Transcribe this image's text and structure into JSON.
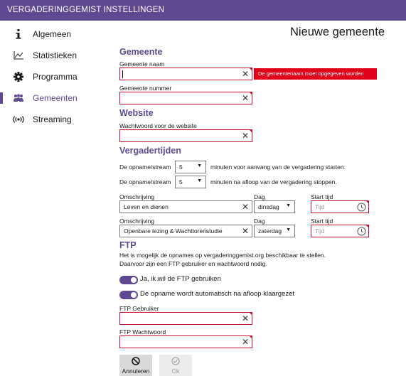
{
  "window": {
    "title": "VERGADERINGGEMIST INSTELLINGEN"
  },
  "sidebar": {
    "items": [
      {
        "label": "Algemeen",
        "icon": "info-icon"
      },
      {
        "label": "Statistieken",
        "icon": "chart-icon"
      },
      {
        "label": "Programma",
        "icon": "gear-icon"
      },
      {
        "label": "Gemeenten",
        "icon": "people-icon",
        "active": true
      },
      {
        "label": "Streaming",
        "icon": "broadcast-icon"
      }
    ]
  },
  "page": {
    "title": "Nieuwe gemeente"
  },
  "gemeente": {
    "heading": "Gemeente",
    "naam_label": "Gemeente naam",
    "naam_value": "",
    "naam_error": "De gemeentenaam moet opgegeven worden",
    "nummer_label": "Gemeente nummer",
    "nummer_value": ""
  },
  "website": {
    "heading": "Website",
    "password_label": "Wachtwoord voor de website",
    "password_value": ""
  },
  "vergadertijden": {
    "heading": "Vergadertijden",
    "start_prefix": "De opname/stream",
    "start_minutes": "5",
    "start_suffix": "minuten voor aanvang van de vergadering starten.",
    "stop_prefix": "De opname/stream",
    "stop_minutes": "5",
    "stop_suffix": "minuten na afloop van de vergadering stoppen.",
    "col_omschrijving": "Omschrijving",
    "col_dag": "Dag",
    "col_start": "Start tijd",
    "rows": [
      {
        "omschrijving": "Leven en dienen",
        "dag": "dinsdag",
        "tijd_placeholder": "Tijd"
      },
      {
        "omschrijving": "Openbare lezing & Wachttorenstudie",
        "dag": "zaterdag",
        "tijd_placeholder": "Tijd"
      }
    ]
  },
  "ftp": {
    "heading": "FTP",
    "description_line1": "Het is mogelijk de opnames op vergaderinggemist.org beschikbaar te stellen.",
    "description_line2": "Daarvoor zijn een FTP gebruiker en wachtwoord nodig.",
    "toggle_use_label": "Ja, ik wil de FTP gebruiken",
    "toggle_use_on": true,
    "toggle_auto_label": "De opname wordt automatisch na afloop klaargezet",
    "toggle_auto_on": true,
    "user_label": "FTP Gebruiker",
    "user_value": "",
    "password_label": "FTP Wachtwoord",
    "password_value": ""
  },
  "actions": {
    "cancel_label": "Annuleren",
    "ok_label": "Ok"
  },
  "colors": {
    "accent": "#5f4a91",
    "error": "#c8102e",
    "error_tip": "#e0001a"
  }
}
